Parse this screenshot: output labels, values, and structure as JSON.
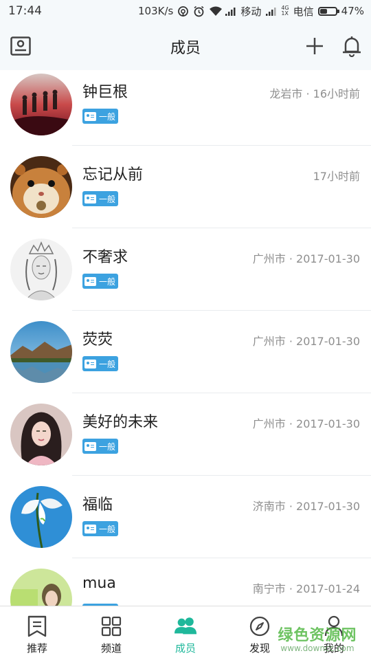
{
  "status_bar": {
    "time": "17:44",
    "speed": "103K/s",
    "carrier1": "移动",
    "net_badge_top": "4G",
    "net_badge_bottom": "1X",
    "carrier2": "电信",
    "battery_text": "47%",
    "battery_level": 0.47
  },
  "header": {
    "title": "成员",
    "left_icon": "contact-card-icon",
    "right_icons": [
      "plus-icon",
      "bell-icon"
    ]
  },
  "members": [
    {
      "name": "钟巨根",
      "meta": "龙岩市 · 16小时前",
      "badge": "一般",
      "avatar": "silhouettes-sunset"
    },
    {
      "name": "忘记从前",
      "meta": "17小时前",
      "badge": "一般",
      "avatar": "hamster"
    },
    {
      "name": "不奢求",
      "meta": "广州市 · 2017-01-30",
      "badge": "一般",
      "avatar": "queen-sketch"
    },
    {
      "name": "荧荧",
      "meta": "广州市 · 2017-01-30",
      "badge": "一般",
      "avatar": "lake-landscape"
    },
    {
      "name": "美好的未来",
      "meta": "广州市 · 2017-01-30",
      "badge": "一般",
      "avatar": "girl-portrait"
    },
    {
      "name": "福临",
      "meta": "济南市 · 2017-01-30",
      "badge": "一般",
      "avatar": "snowdrop-flower"
    },
    {
      "name": "mua",
      "meta": "南宁市 · 2017-01-24",
      "badge": "一般",
      "avatar": "green-portrait"
    }
  ],
  "bottom_nav": {
    "items": [
      {
        "label": "推荐",
        "icon": "bookmark-icon",
        "active": false
      },
      {
        "label": "频道",
        "icon": "grid-icon",
        "active": false
      },
      {
        "label": "成员",
        "icon": "members-icon",
        "active": true
      },
      {
        "label": "发现",
        "icon": "compass-icon",
        "active": false
      },
      {
        "label": "我的",
        "icon": "user-icon",
        "active": false
      }
    ]
  },
  "watermark": {
    "cn": "绿色资源网",
    "en": "www.downcc.com"
  },
  "colors": {
    "accent": "#1fb89b",
    "badge": "#3ca2e0",
    "header_bg": "#f5f9fb"
  }
}
